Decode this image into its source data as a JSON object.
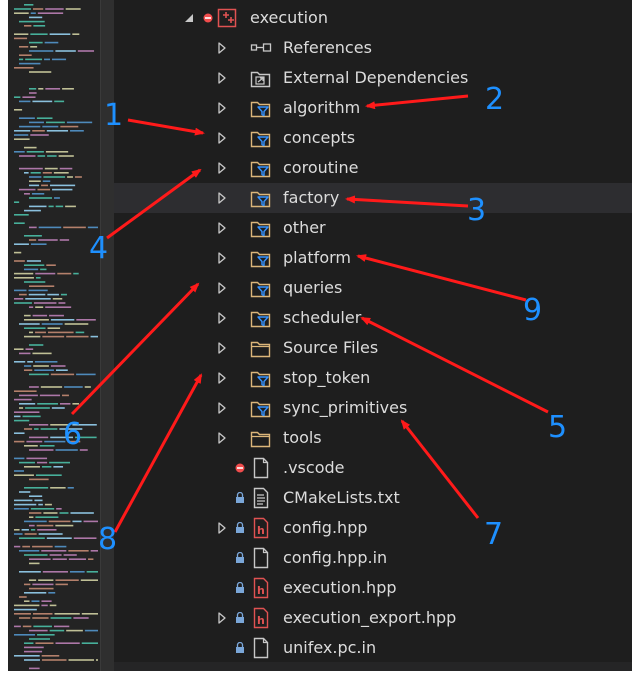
{
  "tree": {
    "root": {
      "label": "execution",
      "expanded": true,
      "status": "excluded",
      "icon": "cmake-project-icon"
    },
    "items": [
      {
        "label": "References",
        "icon": "references-icon",
        "has_children": true,
        "lock": false,
        "status": ""
      },
      {
        "label": "External Dependencies",
        "icon": "external-dependencies-icon",
        "has_children": true,
        "lock": false,
        "status": ""
      },
      {
        "label": "algorithm",
        "icon": "filter-folder-icon",
        "has_children": true,
        "lock": false,
        "status": ""
      },
      {
        "label": "concepts",
        "icon": "filter-folder-icon",
        "has_children": true,
        "lock": false,
        "status": ""
      },
      {
        "label": "coroutine",
        "icon": "filter-folder-icon",
        "has_children": true,
        "lock": false,
        "status": ""
      },
      {
        "label": "factory",
        "icon": "filter-folder-icon",
        "has_children": true,
        "lock": false,
        "status": "",
        "hovered": true
      },
      {
        "label": "other",
        "icon": "filter-folder-icon",
        "has_children": true,
        "lock": false,
        "status": ""
      },
      {
        "label": "platform",
        "icon": "filter-folder-icon",
        "has_children": true,
        "lock": false,
        "status": ""
      },
      {
        "label": "queries",
        "icon": "filter-folder-icon",
        "has_children": true,
        "lock": false,
        "status": ""
      },
      {
        "label": "scheduler",
        "icon": "filter-folder-icon",
        "has_children": true,
        "lock": false,
        "status": ""
      },
      {
        "label": "Source Files",
        "icon": "folder-icon",
        "has_children": true,
        "lock": false,
        "status": ""
      },
      {
        "label": "stop_token",
        "icon": "filter-folder-icon",
        "has_children": true,
        "lock": false,
        "status": ""
      },
      {
        "label": "sync_primitives",
        "icon": "filter-folder-icon",
        "has_children": true,
        "lock": false,
        "status": ""
      },
      {
        "label": "tools",
        "icon": "folder-icon",
        "has_children": true,
        "lock": false,
        "status": ""
      },
      {
        "label": ".vscode",
        "icon": "file-icon",
        "has_children": false,
        "lock": false,
        "status": "excluded"
      },
      {
        "label": "CMakeLists.txt",
        "icon": "text-file-icon",
        "has_children": false,
        "lock": true,
        "status": ""
      },
      {
        "label": "config.hpp",
        "icon": "header-file-icon",
        "has_children": true,
        "lock": true,
        "status": ""
      },
      {
        "label": "config.hpp.in",
        "icon": "file-icon",
        "has_children": false,
        "lock": true,
        "status": ""
      },
      {
        "label": "execution.hpp",
        "icon": "header-file-icon",
        "has_children": false,
        "lock": true,
        "status": ""
      },
      {
        "label": "execution_export.hpp",
        "icon": "header-file-icon",
        "has_children": true,
        "lock": true,
        "status": ""
      },
      {
        "label": "unifex.pc.in",
        "icon": "file-icon",
        "has_children": false,
        "lock": true,
        "status": ""
      }
    ]
  },
  "annotations": [
    {
      "label": "1"
    },
    {
      "label": "2"
    },
    {
      "label": "3"
    },
    {
      "label": "4"
    },
    {
      "label": "5"
    },
    {
      "label": "6"
    },
    {
      "label": "7"
    },
    {
      "label": "8"
    },
    {
      "label": "9"
    }
  ],
  "colors": {
    "background": "#1e1e1e",
    "text": "#dcdcdc",
    "hover_row": "#2d2d30",
    "annotation_text": "#1e90ff",
    "arrow": "#ff1a1a",
    "filter_folder": "#dcb67a",
    "filter_funnel": "#3794ff",
    "excluded_marker": "#f14c4c",
    "header_file": "#e05252"
  }
}
